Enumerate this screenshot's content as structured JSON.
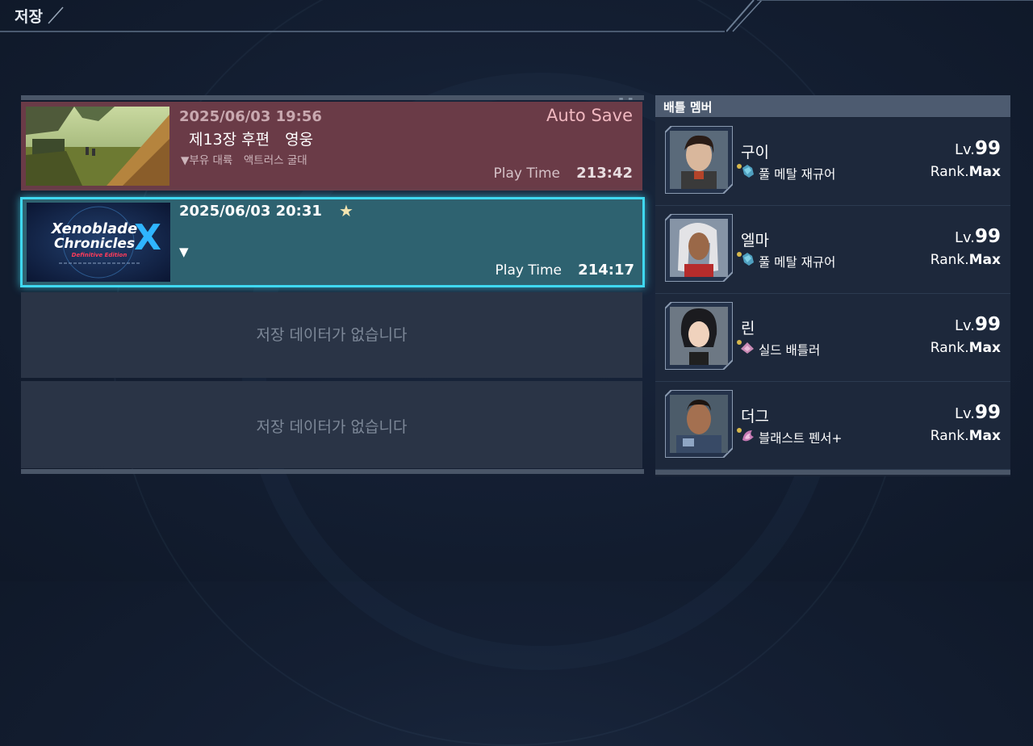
{
  "header": {
    "title": "저장"
  },
  "slots": [
    {
      "date": "2025/06/03 19:56",
      "chapter": "제13장 후편　영웅",
      "location": "▼부유 대륙　액트러스 굴대",
      "badge": "Auto Save",
      "playtime_label": "Play Time",
      "playtime": "213:42",
      "thumbnail": "scenic-landscape"
    },
    {
      "date": "2025/06/03 20:31",
      "starred_icon": "★",
      "location": "▼",
      "playtime_label": "Play Time",
      "playtime": "214:17",
      "thumbnail_title_1": "Xenoblade",
      "thumbnail_title_2": "Chronicles",
      "thumbnail_subtitle": "Definitive Edition",
      "thumbnail_x": "X",
      "selected": true
    },
    {
      "empty_text": "저장 데이터가 없습니다"
    },
    {
      "empty_text": "저장 데이터가 없습니다"
    }
  ],
  "party": {
    "title": "배틀 멤버",
    "members": [
      {
        "name": "구이",
        "class": "풀 메탈 재규어",
        "lv_label": "Lv.",
        "lv": "99",
        "rank_label": "Rank.",
        "rank": "Max",
        "class_icon": "jaguar-class-icon"
      },
      {
        "name": "엘마",
        "class": "풀 메탈 재규어",
        "lv_label": "Lv.",
        "lv": "99",
        "rank_label": "Rank.",
        "rank": "Max",
        "class_icon": "jaguar-class-icon"
      },
      {
        "name": "린",
        "class": "실드 배틀러",
        "lv_label": "Lv.",
        "lv": "99",
        "rank_label": "Rank.",
        "rank": "Max",
        "class_icon": "shield-class-icon"
      },
      {
        "name": "더그",
        "class": "블래스트 펜서+",
        "lv_label": "Lv.",
        "lv": "99",
        "rank_label": "Rank.",
        "rank": "Max",
        "class_icon": "blast-class-icon"
      }
    ]
  },
  "colors": {
    "selected_border": "#3fd8f0",
    "autosave_slot": "#6a3b47",
    "selected_slot": "#2e6270",
    "empty_slot": "#2a3446"
  }
}
